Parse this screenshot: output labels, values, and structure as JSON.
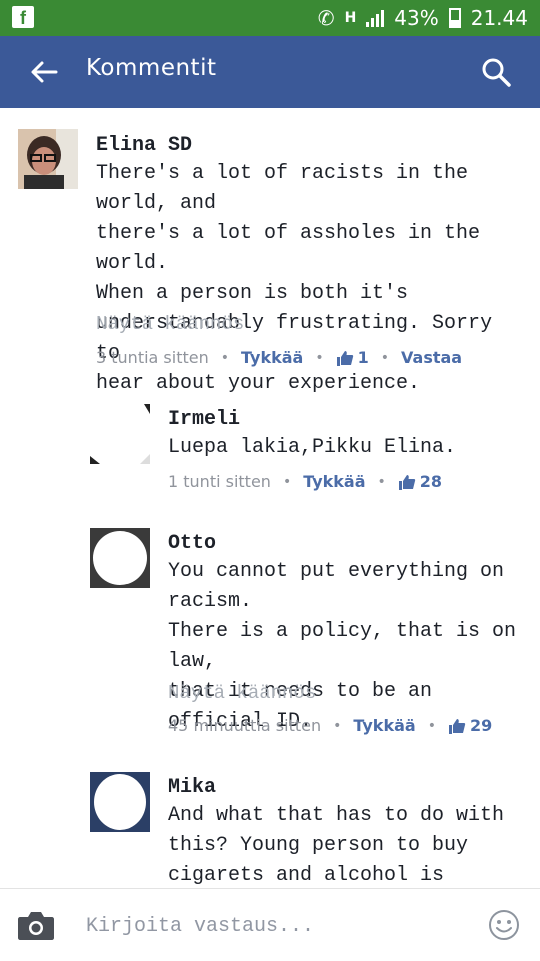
{
  "status_bar": {
    "battery": "43%",
    "time": "21.44",
    "network": "H"
  },
  "app_bar": {
    "title": "Kommentit"
  },
  "comments": [
    {
      "author": "Elina SD",
      "text": "There's a lot of racists in the world, and\nthere's a lot of assholes in the world.\nWhen a person is both it's\nunderstandably frustrating. Sorry to\nhear about your experience.",
      "translate_label": "Näytä käännös",
      "time": "3 tuntia sitten",
      "like_label": "Tykkää",
      "like_count": "1",
      "reply_label": "Vastaa"
    },
    {
      "author": "Irmeli",
      "text": "Luepa lakia,Pikku Elina.",
      "time": "1 tunti sitten",
      "like_label": "Tykkää",
      "like_count": "28"
    },
    {
      "author": "Otto",
      "text": "You cannot put everything on\nracism.\nThere is a policy, that is on law,\nthat it needs to be an official ID.",
      "translate_label": "Näytä käännös",
      "time": "45 minuuttia sitten",
      "like_label": "Tykkää",
      "like_count": "29"
    },
    {
      "author": "Mika",
      "text": "And what that has to do with\nthis? Young person to buy\ncigarets and alcohol is required to"
    }
  ],
  "composer": {
    "placeholder": "Kirjoita vastaus..."
  },
  "colors": {
    "status_bar": "#3a8a34",
    "app_bar": "#3b5998",
    "link": "#4b6ca8"
  }
}
